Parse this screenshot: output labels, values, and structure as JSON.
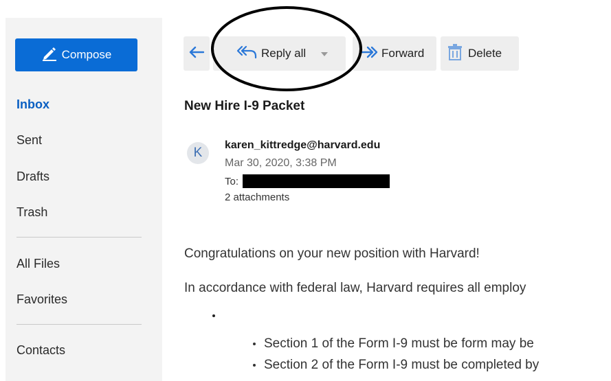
{
  "sidebar": {
    "compose_label": "Compose",
    "items": [
      {
        "label": "Inbox",
        "active": true
      },
      {
        "label": "Sent"
      },
      {
        "label": "Drafts"
      },
      {
        "label": "Trash"
      },
      {
        "label": "All Files"
      },
      {
        "label": "Favorites"
      },
      {
        "label": "Contacts"
      }
    ]
  },
  "toolbar": {
    "reply_all_label": "Reply all",
    "forward_label": "Forward",
    "delete_label": "Delete"
  },
  "message": {
    "subject": "New Hire I-9 Packet",
    "avatar_initial": "K",
    "sender": "karen_kittredge@harvard.edu",
    "date": "Mar 30, 2020, 3:38 PM",
    "to_label": "To:",
    "attachments": "2 attachments",
    "body": [
      "Congratulations on your new position with Harvard!",
      "In accordance with federal law, Harvard requires all employ"
    ],
    "bullets": [
      "Section 1 of the Form I-9 must be form may be",
      "Section 2 of the Form I-9 must be completed by"
    ]
  },
  "colors": {
    "accent": "#0a6cd6",
    "active_nav": "#0a5fc2",
    "sidebar_bg": "#f3f3f3",
    "toolbar_btn_bg": "#eeeeee",
    "icon_blue": "#2b78d8"
  }
}
